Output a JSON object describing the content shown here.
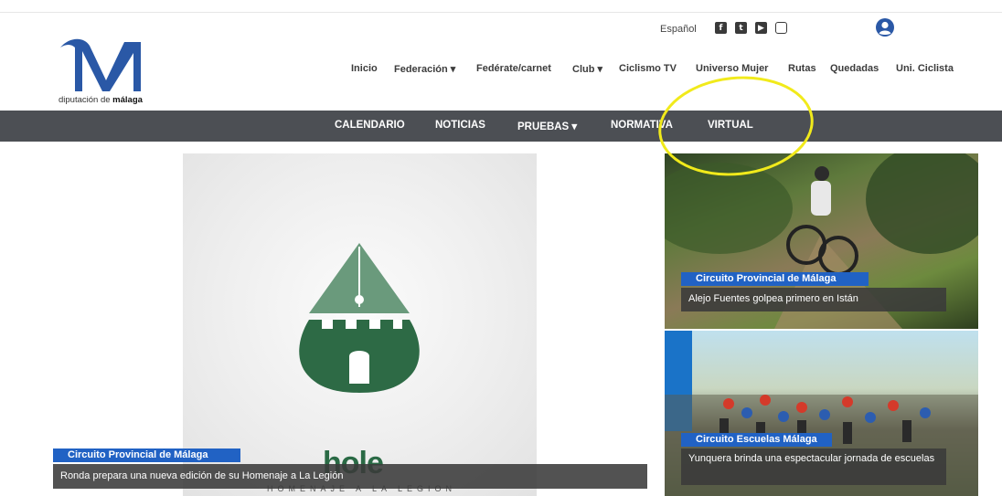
{
  "logo": {
    "text_regular": "diputación de ",
    "text_bold": "málaga"
  },
  "header": {
    "language": "Español",
    "social": [
      {
        "name": "facebook-icon",
        "glyph": "f"
      },
      {
        "name": "twitter-icon",
        "glyph": "t"
      },
      {
        "name": "youtube-icon",
        "glyph": "▶"
      },
      {
        "name": "instagram-icon",
        "glyph": ""
      }
    ]
  },
  "topnav": {
    "inicio": "Inicio",
    "federacion": "Federación ▾",
    "federate": "Fedérate/carnet",
    "club": "Club ▾",
    "ciclismo_tv": "Ciclismo TV",
    "universo_mujer": "Universo Mujer",
    "rutas": "Rutas",
    "quedadas": "Quedadas",
    "uni_ciclista": "Uni. Ciclista"
  },
  "menubar": {
    "calendario": "CALENDARIO",
    "noticias": "NOTICIAS",
    "pruebas": "PRUEBAS ▾",
    "normativa": "NORMATIVA",
    "virtual": "VIRTUAL"
  },
  "feature": {
    "logo_word": "hole",
    "logo_sub": "HOMENAJE A LA LEGION",
    "tag": "Circuito Provincial de Málaga",
    "caption": "Ronda prepara una nueva edición de su Homenaje a La Legión"
  },
  "news": [
    {
      "tag": "Circuito Provincial de Málaga",
      "caption": "Alejo Fuentes golpea primero en Istán"
    },
    {
      "tag": "Circuito Escuelas Málaga",
      "caption": "Yunquera brinda una espectacular jornada de escuelas"
    }
  ],
  "colors": {
    "brand_blue": "#2a58a6",
    "tag_blue": "#2162c4",
    "menubar": "#4c4f54",
    "annotation": "#f1ea1b",
    "logo_green": "#2a6a45"
  }
}
